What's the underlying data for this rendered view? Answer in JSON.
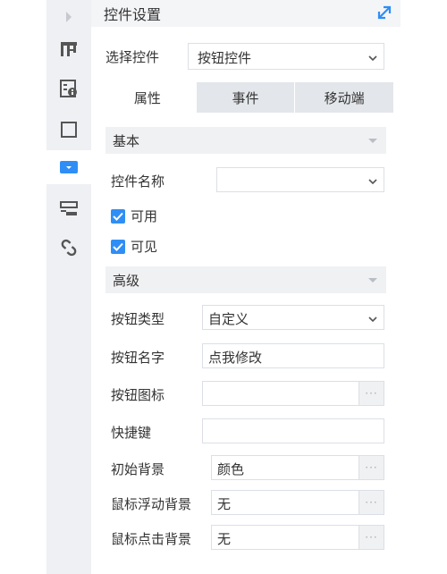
{
  "panel": {
    "title": "控件设置"
  },
  "selector": {
    "label": "选择控件",
    "value": "按钮控件"
  },
  "tabs": [
    {
      "label": "属性"
    },
    {
      "label": "事件"
    },
    {
      "label": "移动端"
    }
  ],
  "basic": {
    "section_label": "基本",
    "name_label": "控件名称",
    "name_value": "",
    "enabled_label": "可用",
    "visible_label": "可见"
  },
  "advanced": {
    "section_label": "高级",
    "button_type_label": "按钮类型",
    "button_type_value": "自定义",
    "button_name_label": "按钮名字",
    "button_name_value": "点我修改",
    "button_icon_label": "按钮图标",
    "button_icon_value": "",
    "hotkey_label": "快捷键",
    "hotkey_value": "",
    "init_bg_label": "初始背景",
    "init_bg_value": "颜色",
    "hover_bg_label": "鼠标浮动背景",
    "hover_bg_value": "无",
    "click_bg_label": "鼠标点击背景",
    "click_bg_value": "无",
    "dots": "···"
  },
  "colors": {
    "accent": "#2f8ef5",
    "rail": "#eef0f3",
    "section": "#f0f1f3"
  },
  "icons": [
    "collapse-arrow-icon",
    "layout-icon",
    "form-icon",
    "frame-icon",
    "widget-icon",
    "report-icon",
    "link-icon",
    "expand-icon",
    "chevron-down-icon",
    "checkbox-icon",
    "more-icon"
  ]
}
